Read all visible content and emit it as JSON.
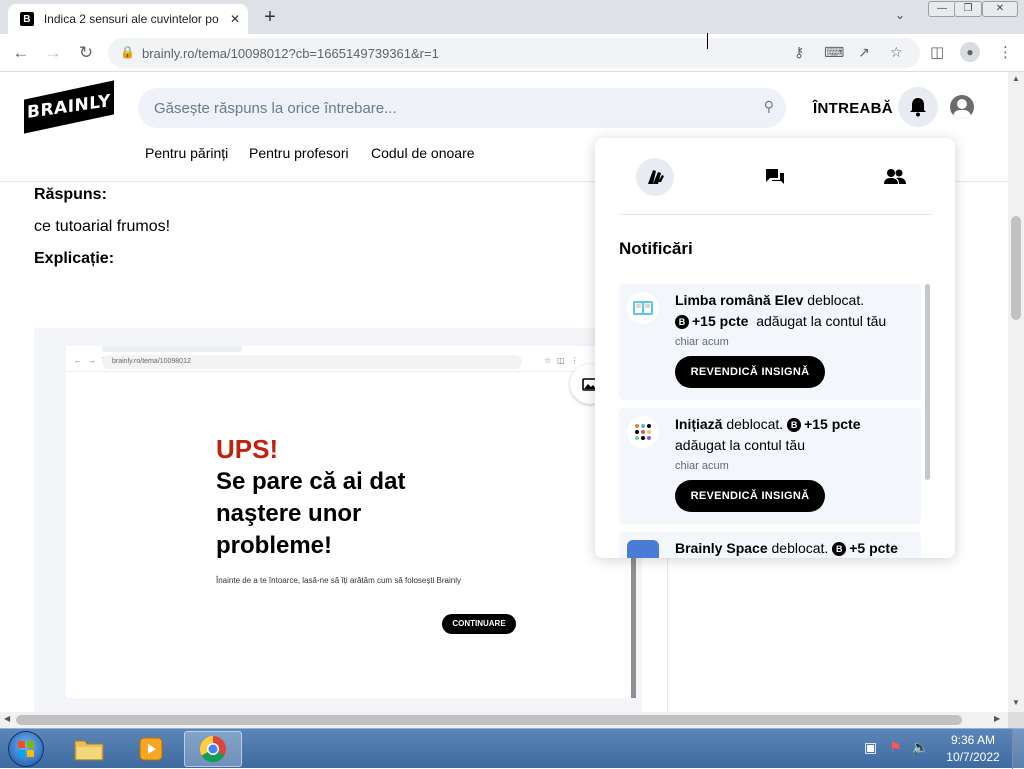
{
  "browser": {
    "tab_title": "Indica 2 sensuri ale cuvintelor po",
    "tab_favicon": "B",
    "tab_close": "✕",
    "new_tab": "+",
    "url": "brainly.ro/tema/10098012?cb=1665149739361&r=1"
  },
  "header": {
    "logo": "BRAINLY",
    "search_placeholder": "Găsește răspuns la orice întrebare...",
    "ask_label": "ÎNTREABĂ",
    "nav": [
      "Pentru părinți",
      "Pentru profesori",
      "Codul de onoare"
    ]
  },
  "answer": {
    "label": "Răspuns:",
    "text": "ce tutoarial frumos!",
    "explanation_label": "Explicație:"
  },
  "embedded_image": {
    "url": "brainly.ro/tema/10098012",
    "ups": "UPS!",
    "headline": "Se pare că ai dat naştere unor probleme!",
    "subtext": "Înainte de a te întoarce, lasă-ne să îți arătăm cum să folosești Brainly",
    "button": "CONTINUARE"
  },
  "notifications": {
    "title": "Notificări",
    "items": [
      {
        "subject": "Limba română Elev",
        "status": "deblocat.",
        "points": "+15 pcte",
        "suffix": "adăugat la contul tău",
        "time": "chiar acum",
        "button": "REVENDICĂ INSIGNĂ"
      },
      {
        "subject": "Inițiază",
        "status": "deblocat.",
        "points": "+15 pcte",
        "suffix": "adăugat la contul tău",
        "time": "chiar acum",
        "button": "REVENDICĂ INSIGNĂ"
      },
      {
        "subject": "Brainly Space",
        "status": "deblocat.",
        "points": "+5 pcte"
      }
    ],
    "points_badge": "B"
  },
  "taskbar": {
    "time": "9:36 AM",
    "date": "10/7/2022"
  },
  "colors": {
    "ups_red": "#c1220f",
    "search_bg": "#eef2f8",
    "card_bg": "#f3f6fa"
  }
}
